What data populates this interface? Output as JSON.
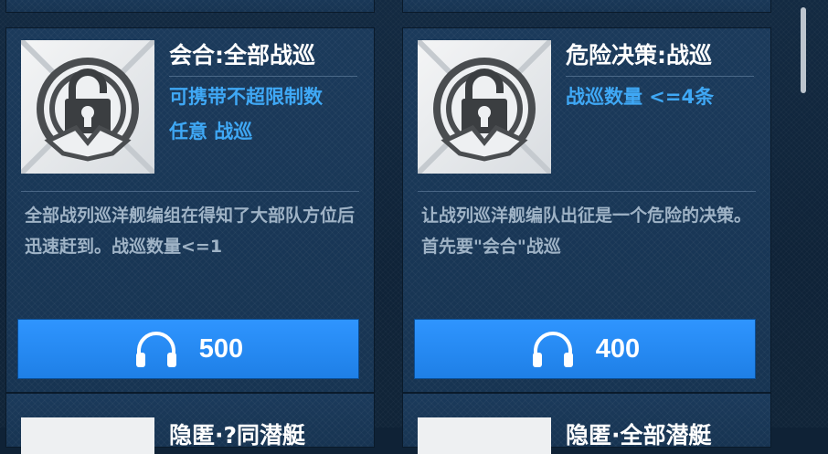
{
  "cards": [
    {
      "title": "会合:全部战巡",
      "tags": [
        "可携带不超限制数",
        "任意 战巡"
      ],
      "description": "全部战列巡洋舰编组在得知了大部队方位后迅速赶到。战巡数量<=1",
      "price": "500",
      "icon": "lock-icon"
    },
    {
      "title": "危险决策:战巡",
      "tags": [
        "战巡数量 <=4条"
      ],
      "description": "让战列巡洋舰编队出征是一个危险的决策。首先要\"会合\"战巡",
      "price": "400",
      "icon": "lock-icon"
    }
  ],
  "partial_cards": [
    {
      "title": "隐匿·?同潜艇"
    },
    {
      "title": "隐匿·全部潜艇"
    }
  ],
  "currency_icon": "headphones-icon",
  "colors": {
    "accent_blue": "#3fa8f5",
    "button_blue": "#2f95ff",
    "card_bg": "#1b3a5b"
  }
}
